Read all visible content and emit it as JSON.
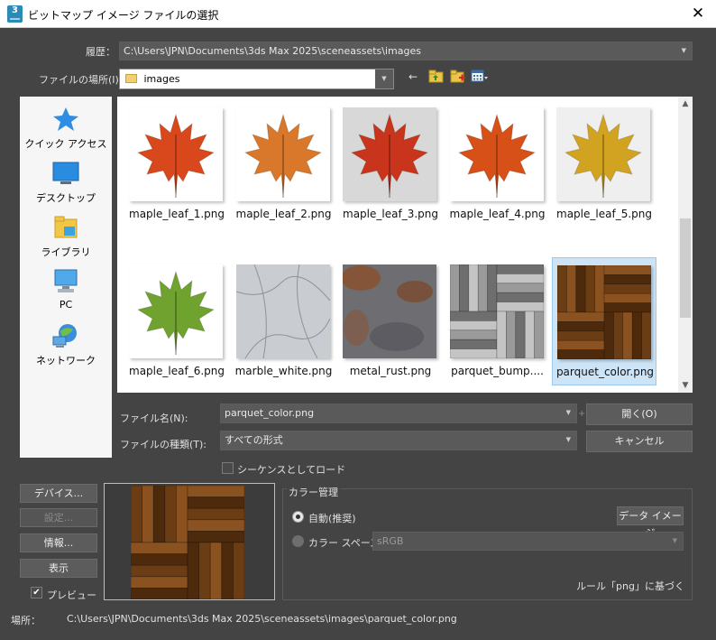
{
  "window": {
    "title": "ビットマップ イメージ ファイルの選択",
    "app_icon_text": "3"
  },
  "history": {
    "label": "履歴：",
    "value": "C:\\Users\\JPN\\Documents\\3ds Max 2025\\sceneassets\\images"
  },
  "lookin": {
    "label": "ファイルの場所(I):",
    "value": "images"
  },
  "places": [
    {
      "label": "クイック アクセス",
      "icon": "star-icon"
    },
    {
      "label": "デスクトップ",
      "icon": "desktop-icon"
    },
    {
      "label": "ライブラリ",
      "icon": "library-icon"
    },
    {
      "label": "PC",
      "icon": "computer-icon"
    },
    {
      "label": "ネットワーク",
      "icon": "network-icon"
    }
  ],
  "files": [
    {
      "name": "maple_leaf_1.png",
      "kind": "leaf",
      "color": "#d9481c",
      "bg": "#ffffff"
    },
    {
      "name": "maple_leaf_2.png",
      "kind": "leaf",
      "color": "#d9772a",
      "bg": "#ffffff"
    },
    {
      "name": "maple_leaf_3.png",
      "kind": "leaf",
      "color": "#c9351c",
      "bg": "#d8d8d8"
    },
    {
      "name": "maple_leaf_4.png",
      "kind": "leaf",
      "color": "#d65017",
      "bg": "#ffffff"
    },
    {
      "name": "maple_leaf_5.png",
      "kind": "leaf",
      "color": "#d1a321",
      "bg": "#efefef"
    },
    {
      "name": "maple_leaf_6.png",
      "kind": "leaf",
      "color": "#6fa22f",
      "bg": "#ffffff"
    },
    {
      "name": "marble_white.png",
      "kind": "marble",
      "color": "#c9ccd0",
      "bg": "#c9ccd0"
    },
    {
      "name": "metal_rust.png",
      "kind": "rust",
      "color": "#6e6e72",
      "bg": "#6e6e72"
    },
    {
      "name": "parquet_bump....",
      "kind": "parquet-gray",
      "color": "#8a8a8a",
      "bg": "#8a8a8a"
    },
    {
      "name": "parquet_color.png",
      "kind": "parquet-wood",
      "color": "#6b3d14",
      "bg": "#6b3d14",
      "selected": true
    }
  ],
  "filename": {
    "label": "ファイル名(N):",
    "value": "parquet_color.png"
  },
  "filetype": {
    "label": "ファイルの種類(T):",
    "value": "すべての形式"
  },
  "buttons": {
    "open": "開く(O)",
    "cancel": "キャンセル",
    "devices": "デバイス...",
    "setup": "設定...",
    "info": "情報...",
    "view": "表示"
  },
  "sequence": {
    "label": "シーケンスとしてロード",
    "checked": false
  },
  "preview": {
    "label": "プレビュー",
    "checked": true
  },
  "color_management": {
    "title": "カラー管理",
    "auto_label": "自動(推奨)",
    "colorspace_label": "カラー スペース:",
    "colorspace_value": "sRGB",
    "data_image_button": "データ イメージ",
    "rule_text": "ルール「png」に基づく",
    "selected": "auto"
  },
  "location": {
    "label": "場所：",
    "value": "C:\\Users\\JPN\\Documents\\3ds Max 2025\\sceneassets\\images\\parquet_color.png"
  }
}
